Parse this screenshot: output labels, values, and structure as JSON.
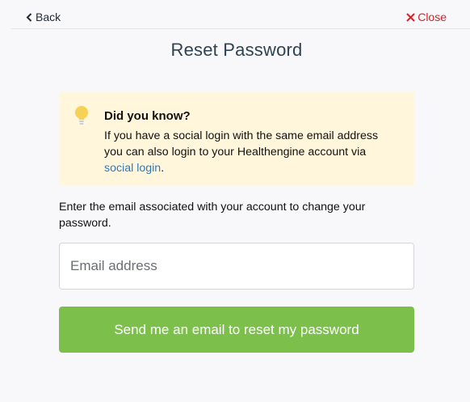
{
  "header": {
    "back_label": "Back",
    "close_label": "Close",
    "back_icon": "chevron-left-icon",
    "close_icon": "x-icon"
  },
  "page": {
    "title": "Reset Password"
  },
  "tip": {
    "icon": "lightbulb-icon",
    "title": "Did you know?",
    "body_before": "If you have a social login with the same email address you can also login to your Healthengine account via ",
    "link_label": "social login",
    "body_after": "."
  },
  "form": {
    "instructions": "Enter the email associated with your account to change your password.",
    "email_placeholder": "Email address",
    "email_value": "",
    "submit_label": "Send me an email to reset my password"
  },
  "colors": {
    "accent_green": "#7cc04b",
    "close_red": "#d3222a",
    "link_blue": "#2b7bbd",
    "tip_background": "#fff6dc",
    "bulb_yellow": "#f7d154"
  }
}
